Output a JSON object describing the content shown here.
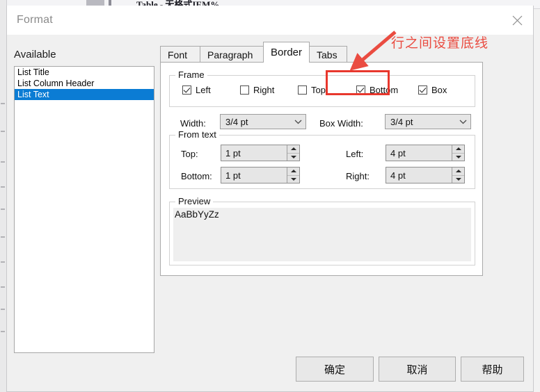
{
  "background": {
    "document_title": "Table - 无格式IEM%"
  },
  "dialog": {
    "title": "Format",
    "close_icon": "close-icon"
  },
  "available": {
    "label": "Available",
    "items": [
      {
        "label": "List Title",
        "selected": false
      },
      {
        "label": "List Column Header",
        "selected": false
      },
      {
        "label": "List Text",
        "selected": true
      }
    ]
  },
  "tabs": [
    {
      "label": "Font",
      "active": false
    },
    {
      "label": "Paragraph",
      "active": false
    },
    {
      "label": "Border",
      "active": true
    },
    {
      "label": "Tabs",
      "active": false
    }
  ],
  "frame": {
    "legend": "Frame",
    "checkboxes": [
      {
        "label": "Left",
        "checked": true
      },
      {
        "label": "Right",
        "checked": false
      },
      {
        "label": "Top",
        "checked": false
      },
      {
        "label": "Bottom",
        "checked": true
      },
      {
        "label": "Box",
        "checked": true
      }
    ]
  },
  "width_row": {
    "width_label": "Width:",
    "width_value": "3/4 pt",
    "box_width_label": "Box Width:",
    "box_width_value": "3/4 pt"
  },
  "from_text": {
    "legend": "From text",
    "fields": [
      {
        "label": "Top:",
        "value": "1 pt"
      },
      {
        "label": "Bottom:",
        "value": "1 pt"
      },
      {
        "label": "Left:",
        "value": "4 pt"
      },
      {
        "label": "Right:",
        "value": "4 pt"
      }
    ]
  },
  "preview": {
    "legend": "Preview",
    "sample": "AaBbYyZz"
  },
  "annotation": {
    "text": "行之间设置底线",
    "color": "#ea4c41",
    "highlight_color": "#e8372d"
  },
  "buttons": [
    {
      "label": "确定"
    },
    {
      "label": "取消"
    },
    {
      "label": "帮助"
    }
  ],
  "colors": {
    "selection_blue": "#0b7cd4",
    "dialog_bg": "#f0f0f0",
    "panel_white": "#ffffff"
  }
}
